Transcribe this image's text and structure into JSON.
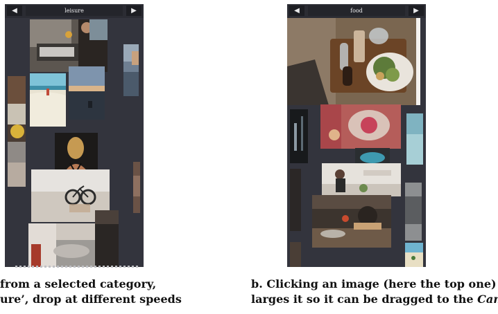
{
  "panel_a": {
    "category": "leisure",
    "prev_glyph": "◀",
    "next_glyph": "▶"
  },
  "panel_b": {
    "category": "food",
    "prev_glyph": "◀",
    "next_glyph": "▶"
  },
  "captions": {
    "a_line1": "from a selected category,",
    "a_line2": "ure’, drop at different speeds",
    "b_line1": "b. Clicking an image (here the top one) en-",
    "b_line2_prefix": "larges it so it can be dragged to the ",
    "b_line2_emph": "Canvas"
  },
  "icons": [
    "prev-arrow-icon",
    "next-arrow-icon"
  ],
  "colors": {
    "panel_bg": "#33343d",
    "header_bg": "#2b2c33",
    "button_bg": "#1d1e23"
  }
}
